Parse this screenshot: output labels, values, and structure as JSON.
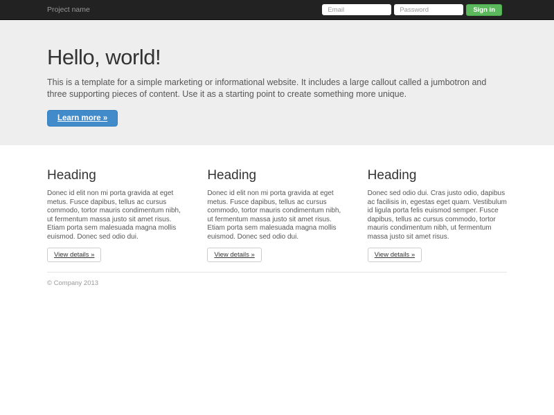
{
  "navbar": {
    "brand": "Project name",
    "email_placeholder": "Email",
    "password_placeholder": "Password",
    "sign_in_label": "Sign in"
  },
  "jumbotron": {
    "title": "Hello, world!",
    "description": "This is a template for a simple marketing or informational website. It includes a large callout called a jumbotron and three supporting pieces of content. Use it as a starting point to create something more unique.",
    "cta_label": "Learn more »"
  },
  "columns": [
    {
      "heading": "Heading",
      "text": "Donec id elit non mi porta gravida at eget metus. Fusce dapibus, tellus ac cursus commodo, tortor mauris condimentum nibh, ut fermentum massa justo sit amet risus. Etiam porta sem malesuada magna mollis euismod. Donec sed odio dui.",
      "button_label": "View details »"
    },
    {
      "heading": "Heading",
      "text": "Donec id elit non mi porta gravida at eget metus. Fusce dapibus, tellus ac cursus commodo, tortor mauris condimentum nibh, ut fermentum massa justo sit amet risus. Etiam porta sem malesuada magna mollis euismod. Donec sed odio dui.",
      "button_label": "View details »"
    },
    {
      "heading": "Heading",
      "text": "Donec sed odio dui. Cras justo odio, dapibus ac facilisis in, egestas eget quam. Vestibulum id ligula porta felis euismod semper. Fusce dapibus, tellus ac cursus commodo, tortor mauris condimentum nibh, ut fermentum massa justo sit amet risus.",
      "button_label": "View details »"
    }
  ],
  "footer": {
    "copyright": "© Company 2013"
  },
  "colors": {
    "navbar_bg": "#222222",
    "jumbotron_bg": "#eeeeee",
    "primary_button": "#428bca",
    "success_button": "#5cb85c"
  }
}
